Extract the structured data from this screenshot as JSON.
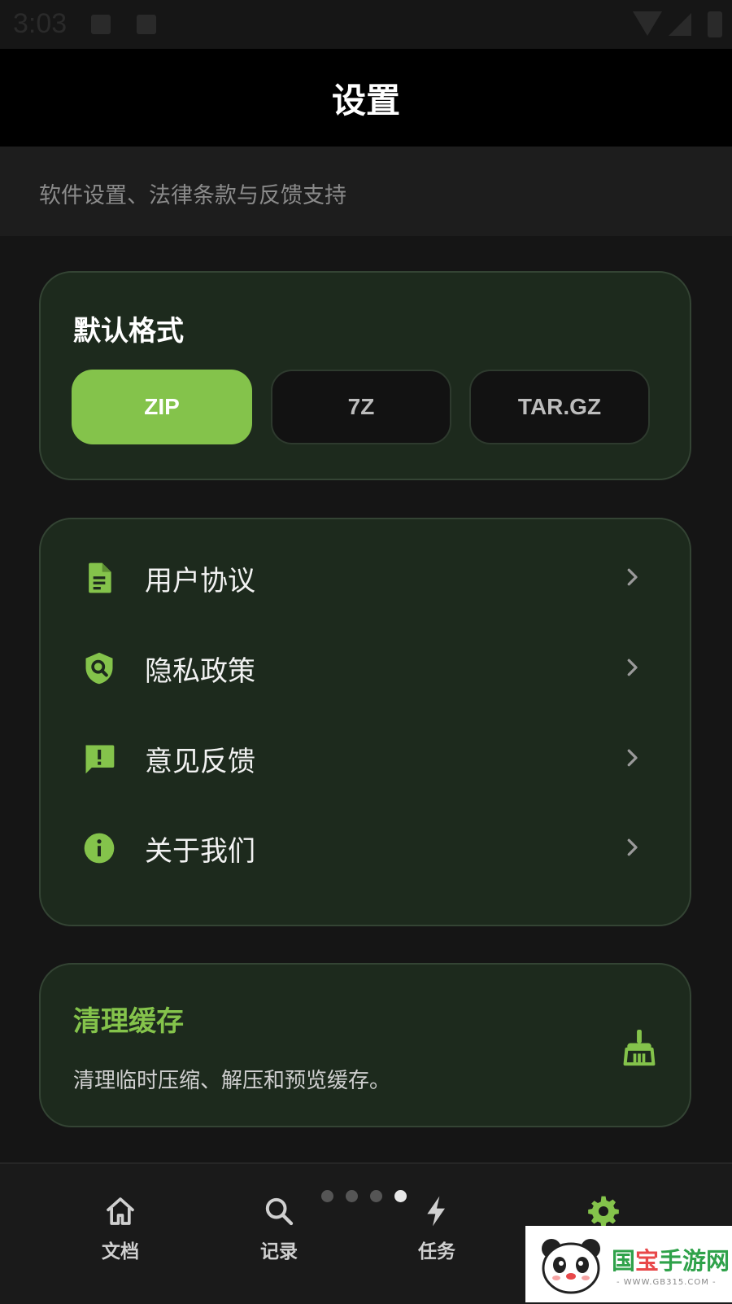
{
  "status_bar": {
    "time": "3:03"
  },
  "header": {
    "title": "设置"
  },
  "subtitle": "软件设置、法律条款与反馈支持",
  "default_format": {
    "title": "默认格式",
    "options": [
      {
        "label": "ZIP",
        "selected": true
      },
      {
        "label": "7Z",
        "selected": false
      },
      {
        "label": "TAR.GZ",
        "selected": false
      }
    ]
  },
  "links": [
    {
      "label": "用户协议",
      "icon": "document-icon"
    },
    {
      "label": "隐私政策",
      "icon": "shield-search-icon"
    },
    {
      "label": "意见反馈",
      "icon": "feedback-icon"
    },
    {
      "label": "关于我们",
      "icon": "info-icon"
    }
  ],
  "cache": {
    "title": "清理缓存",
    "description": "清理临时压缩、解压和预览缓存。",
    "icon": "broom-icon"
  },
  "bottom_nav": {
    "page_indicator": {
      "total": 4,
      "active": 4
    },
    "items": [
      {
        "label": "文档",
        "icon": "home-icon"
      },
      {
        "label": "记录",
        "icon": "search-icon"
      },
      {
        "label": "任务",
        "icon": "bolt-icon"
      },
      {
        "label": "设置",
        "icon": "gear-icon"
      }
    ]
  },
  "watermark": {
    "brand_a": "国",
    "brand_b": "宝",
    "brand_c": "手游网",
    "url": "- WWW.GB315.COM -"
  },
  "colors": {
    "accent": "#84c34b",
    "card_bg": "#1d2a1d",
    "background": "#151515",
    "header_bg": "#000000"
  }
}
